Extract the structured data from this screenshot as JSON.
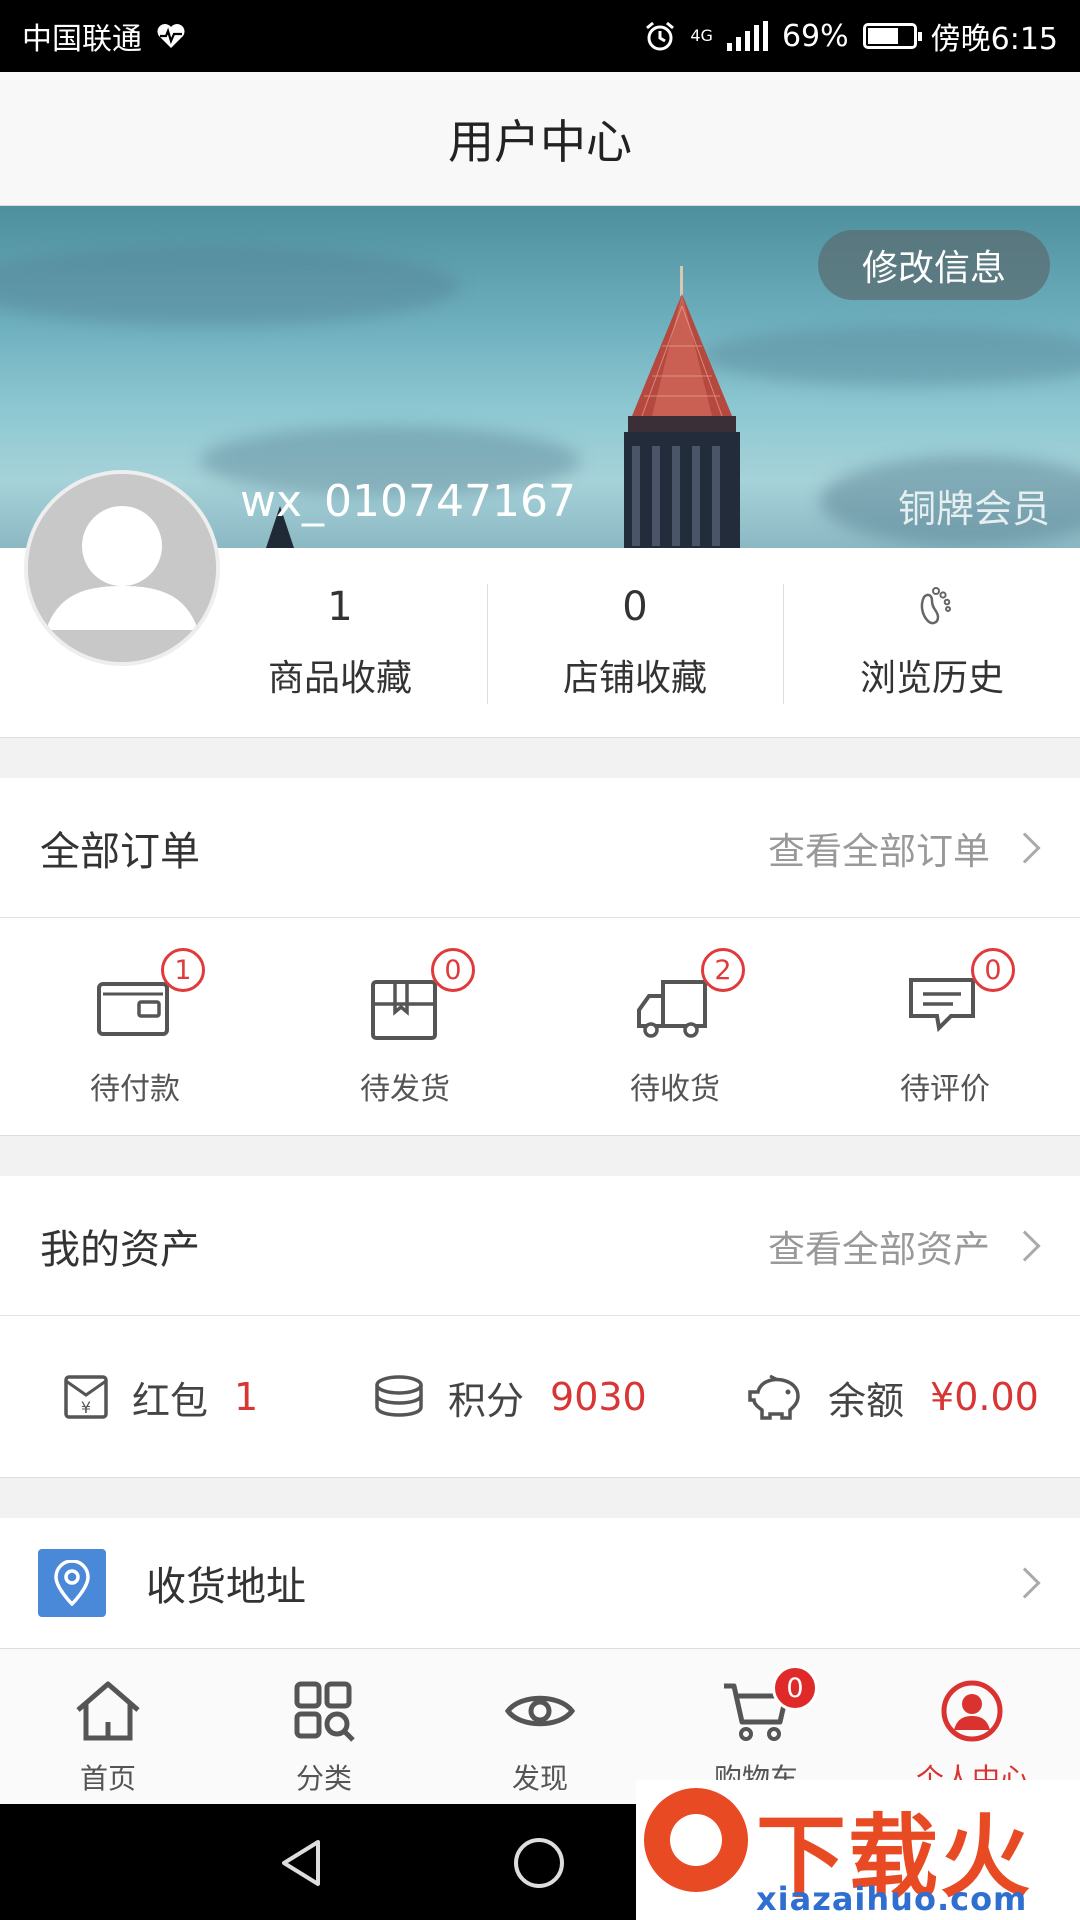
{
  "status_bar": {
    "carrier": "中国联通",
    "network": "4G",
    "battery": "69%",
    "time": "傍晚6:15"
  },
  "header": {
    "title": "用户中心"
  },
  "profile": {
    "edit_label": "修改信息",
    "username": "wx_010747167",
    "member_level": "铜牌会员",
    "stats": [
      {
        "value": "1",
        "label": "商品收藏"
      },
      {
        "value": "0",
        "label": "店铺收藏"
      },
      {
        "value": "",
        "label": "浏览历史"
      }
    ]
  },
  "orders": {
    "title": "全部订单",
    "more": "查看全部订单",
    "items": [
      {
        "label": "待付款",
        "count": "1",
        "icon": "wallet-icon"
      },
      {
        "label": "待发货",
        "count": "0",
        "icon": "package-icon"
      },
      {
        "label": "待收货",
        "count": "2",
        "icon": "truck-icon"
      },
      {
        "label": "待评价",
        "count": "0",
        "icon": "comment-icon"
      }
    ]
  },
  "assets": {
    "title": "我的资产",
    "more": "查看全部资产",
    "items": [
      {
        "label": "红包",
        "value": "1",
        "icon": "red-envelope-icon"
      },
      {
        "label": "积分",
        "value": "9030",
        "icon": "coins-icon"
      },
      {
        "label": "余额",
        "value": "¥0.00",
        "icon": "piggy-bank-icon"
      }
    ]
  },
  "address": {
    "label": "收货地址",
    "icon": "location-pin-icon"
  },
  "tabs": [
    {
      "label": "首页",
      "icon": "home-icon"
    },
    {
      "label": "分类",
      "icon": "category-icon"
    },
    {
      "label": "发现",
      "icon": "eye-icon"
    },
    {
      "label": "购物车",
      "icon": "cart-icon",
      "badge": "0"
    },
    {
      "label": "个人中心",
      "icon": "user-icon",
      "active": true
    }
  ],
  "colors": {
    "accent": "#d9322f",
    "link_blue": "#4a89d8"
  },
  "watermark": {
    "brand": "下载火",
    "url": "xiazaihuo.com"
  }
}
